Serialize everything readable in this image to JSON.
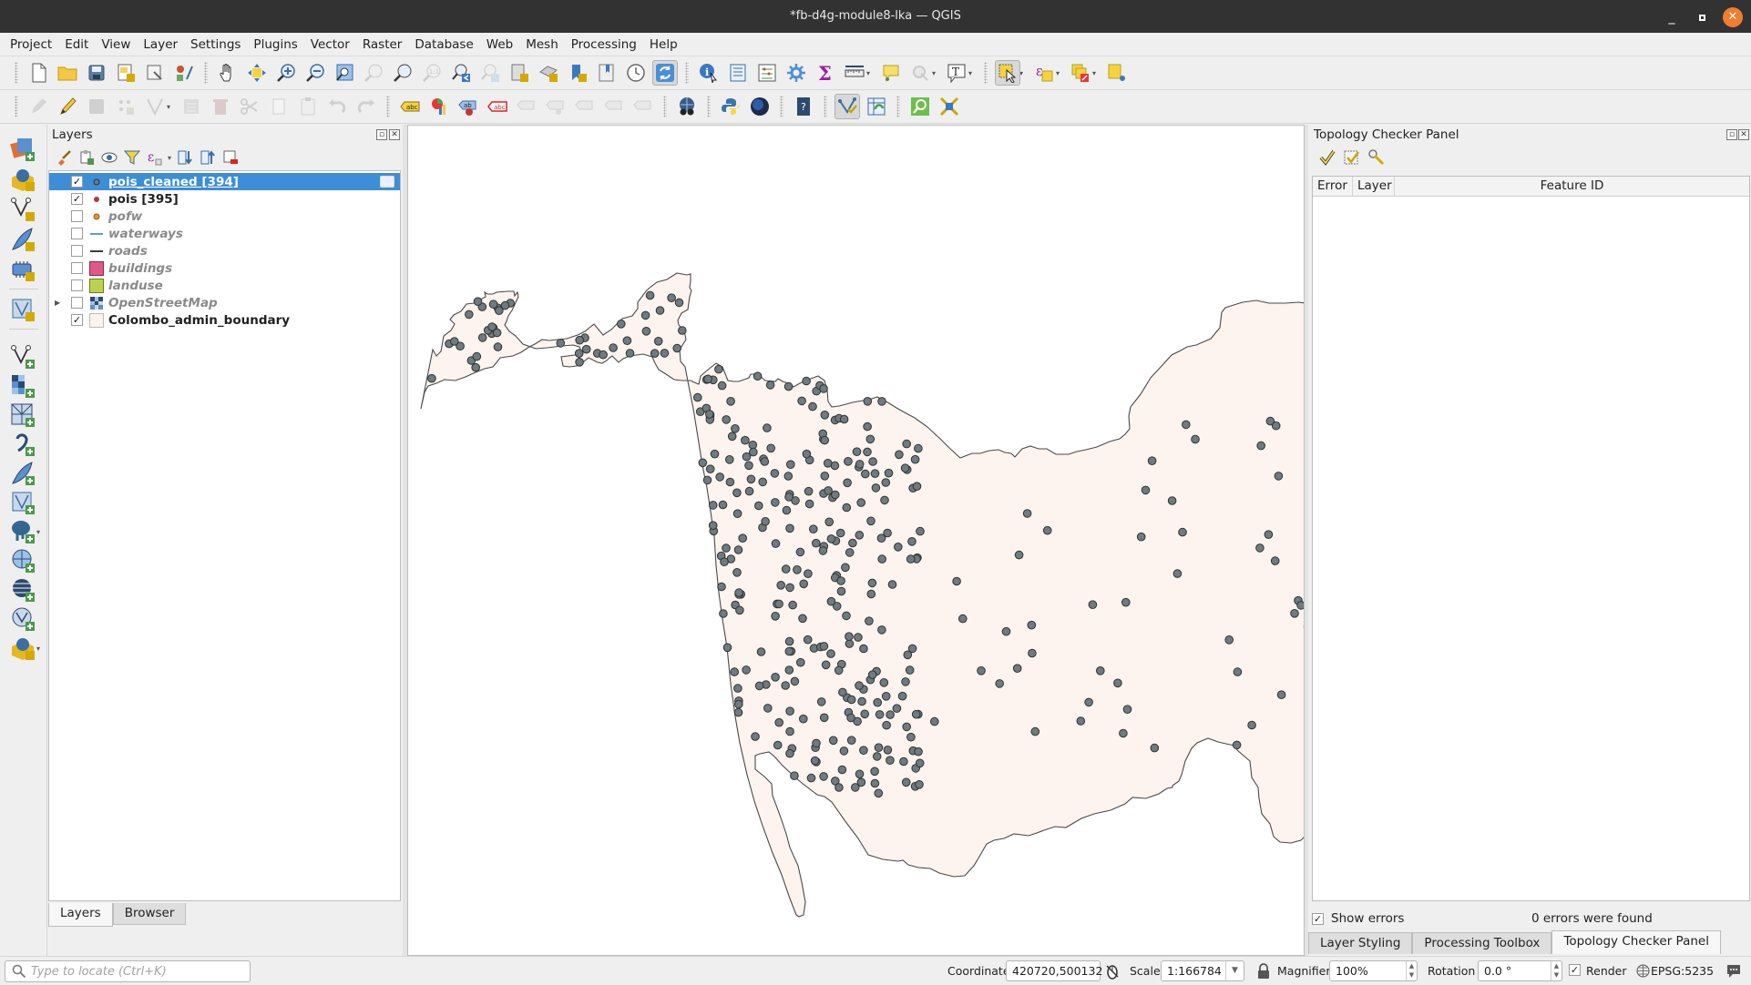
{
  "window": {
    "title": "*fb-d4g-module8-lka — QGIS",
    "minimize": "_",
    "maximize": "▫",
    "close": "✕"
  },
  "menu": [
    "Project",
    "Edit",
    "View",
    "Layer",
    "Settings",
    "Plugins",
    "Vector",
    "Raster",
    "Database",
    "Web",
    "Mesh",
    "Processing",
    "Help"
  ],
  "toolbar1_icons": [
    "new-project-icon",
    "open-project-icon",
    "save-project-icon",
    "new-print-layout-icon",
    "layout-manager-icon",
    "style-manager-icon",
    "pan-icon",
    "pan-to-selection-icon",
    "zoom-in-icon",
    "zoom-out-icon",
    "zoom-full-icon",
    "zoom-to-selection-icon",
    "zoom-to-layer-icon",
    "zoom-native-icon",
    "zoom-last-icon",
    "zoom-next-icon",
    "new-bookmark-icon",
    "show-bookmarks-icon",
    "new-map-view-icon",
    "new-3d-view-icon",
    "temporal-controller-icon",
    "refresh-icon",
    "identify-icon",
    "attribute-table-icon",
    "field-calculator-icon",
    "processing-toolbox-icon",
    "statistics-icon",
    "measure-icon",
    "map-tips-icon",
    "action-icon",
    "text-annotation-icon",
    "select-features-icon",
    "select-by-expression-icon",
    "deselect-icon",
    "select-by-location-icon"
  ],
  "layers_panel": {
    "title": "Layers",
    "layers": [
      {
        "name": "pois_cleaned [394]",
        "checked": true,
        "visible_style": "active",
        "symbol": "point",
        "color": "#6b7b80",
        "selected": true
      },
      {
        "name": "pois [395]",
        "checked": true,
        "visible_style": "active",
        "symbol": "point",
        "color": "#b13a44",
        "selected": false
      },
      {
        "name": "pofw",
        "checked": false,
        "visible_style": "off",
        "symbol": "point",
        "color": "#f0902a",
        "selected": false
      },
      {
        "name": "waterways",
        "checked": false,
        "visible_style": "off",
        "symbol": "line",
        "color": "#5b9bd5",
        "selected": false
      },
      {
        "name": "roads",
        "checked": false,
        "visible_style": "off",
        "symbol": "line",
        "color": "#3a3a3a",
        "selected": false
      },
      {
        "name": "buildings",
        "checked": false,
        "visible_style": "off",
        "symbol": "fill",
        "color": "#e0578a",
        "selected": false
      },
      {
        "name": "landuse",
        "checked": false,
        "visible_style": "off",
        "symbol": "fill",
        "color": "#bcd24e",
        "selected": false
      },
      {
        "name": "OpenStreetMap",
        "checked": false,
        "visible_style": "off",
        "symbol": "raster",
        "color": "#2c4a6e",
        "selected": false,
        "expandable": true
      },
      {
        "name": "Colombo_admin_boundary",
        "checked": true,
        "visible_style": "active",
        "symbol": "fill",
        "color": "#fdf2ee",
        "selected": false
      }
    ],
    "tabs": [
      "Layers",
      "Browser"
    ],
    "active_tab": "Layers"
  },
  "map": {
    "boundary_fill": "#fdf3ef",
    "boundary_stroke": "#4a4a4a",
    "point_fill": "#6f7b7e",
    "point_stroke": "#2e3436",
    "background": "#ffffff"
  },
  "topology_panel": {
    "title": "Topology Checker Panel",
    "columns": [
      "Error",
      "Layer",
      "Feature ID"
    ],
    "show_errors_label": "Show errors",
    "show_errors_checked": true,
    "status": "0 errors were found",
    "tabs": [
      "Layer Styling",
      "Processing Toolbox",
      "Topology Checker Panel"
    ],
    "active_tab": "Topology Checker Panel"
  },
  "statusbar": {
    "locator_placeholder": "Type to locate (Ctrl+K)",
    "coordinate_label": "Coordinate",
    "coordinate_value": "420720,500132",
    "scale_label": "Scale",
    "scale_value": "1:166784",
    "magnifier_label": "Magnifier",
    "magnifier_value": "100%",
    "rotation_label": "Rotation",
    "rotation_value": "0.0 °",
    "render_label": "Render",
    "render_checked": true,
    "crs": "EPSG:5235"
  }
}
